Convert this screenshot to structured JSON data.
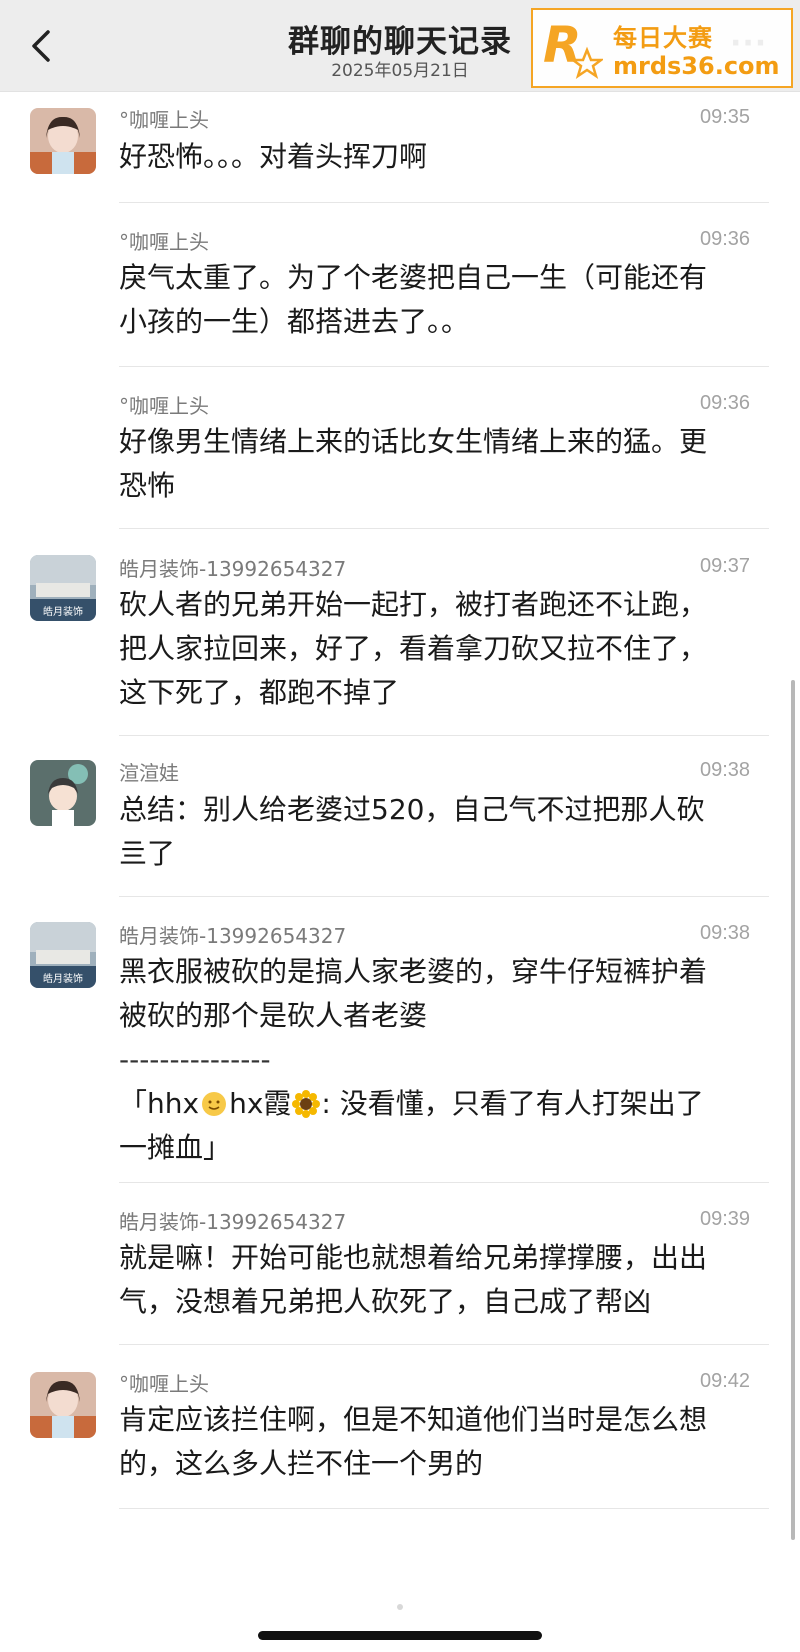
{
  "nav": {
    "title": "群聊的聊天记录",
    "date": "2025年05月21日",
    "more": "···"
  },
  "watermark": {
    "name": "每日大赛",
    "url": "mrds36.com"
  },
  "messages": [
    {
      "sender": "°咖喱上头",
      "time": "09:35",
      "lines": [
        "好恐怖。。。对着头挥刀啊"
      ]
    },
    {
      "sender": "°咖喱上头",
      "time": "09:36",
      "lines": [
        "戾气太重了。为了个老婆把自己一生（可能还有",
        "小孩的一生）都搭进去了。。"
      ]
    },
    {
      "sender": "°咖喱上头",
      "time": "09:36",
      "lines": [
        "好像男生情绪上来的话比女生情绪上来的猛。更",
        "恐怖"
      ]
    },
    {
      "sender": "皓月装饰-13992654327",
      "time": "09:37",
      "lines": [
        "砍人者的兄弟开始一起打，被打者跑还不让跑，",
        "把人家拉回来，好了，看着拿刀砍又拉不住了，",
        "这下死了，都跑不掉了"
      ]
    },
    {
      "sender": "渲渲娃",
      "time": "09:38",
      "lines": [
        "总结：别人给老婆过520，自己气不过把那人砍",
        "亖了"
      ]
    },
    {
      "sender": "皓月装饰-13992654327",
      "time": "09:38",
      "lines": [
        "黑衣服被砍的是搞人家老婆的，穿牛仔短裤护着",
        "被砍的那个是砍人者老婆"
      ],
      "divider": "---------------",
      "quote": {
        "open": "「hhx",
        "mid": "hx霞",
        "rest": ": 没看懂，只看了有人打架出了",
        "line2": "一摊血」"
      }
    },
    {
      "sender": "皓月装饰-13992654327",
      "time": "09:39",
      "lines": [
        "就是嘛！开始可能也就想着给兄弟撑撑腰，出出",
        "气，没想着兄弟把人砍死了，自己成了帮凶"
      ]
    },
    {
      "sender": "°咖喱上头",
      "time": "09:42",
      "lines": [
        "肯定应该拦住啊，但是不知道他们当时是怎么想",
        "的，这么多人拦不住一个男的"
      ]
    }
  ]
}
